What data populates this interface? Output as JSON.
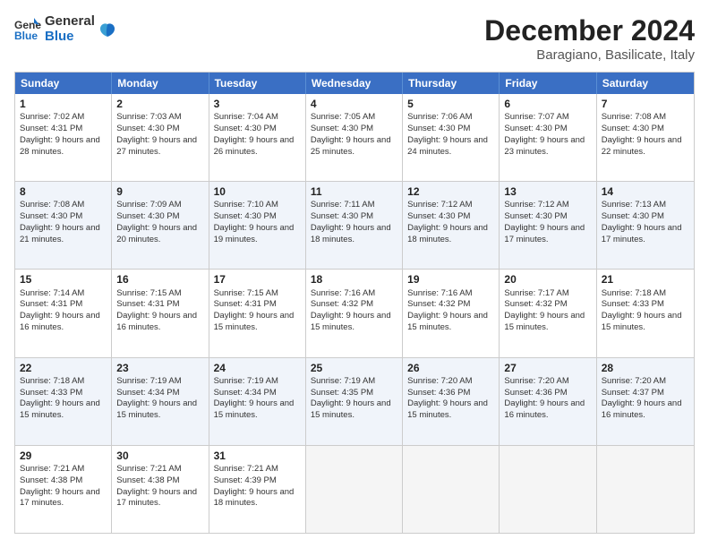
{
  "logo": {
    "line1": "General",
    "line2": "Blue"
  },
  "title": "December 2024",
  "subtitle": "Baragiano, Basilicate, Italy",
  "days": [
    "Sunday",
    "Monday",
    "Tuesday",
    "Wednesday",
    "Thursday",
    "Friday",
    "Saturday"
  ],
  "rows": [
    [
      {
        "day": "1",
        "info": "Sunrise: 7:02 AM\nSunset: 4:31 PM\nDaylight: 9 hours and 28 minutes."
      },
      {
        "day": "2",
        "info": "Sunrise: 7:03 AM\nSunset: 4:30 PM\nDaylight: 9 hours and 27 minutes."
      },
      {
        "day": "3",
        "info": "Sunrise: 7:04 AM\nSunset: 4:30 PM\nDaylight: 9 hours and 26 minutes."
      },
      {
        "day": "4",
        "info": "Sunrise: 7:05 AM\nSunset: 4:30 PM\nDaylight: 9 hours and 25 minutes."
      },
      {
        "day": "5",
        "info": "Sunrise: 7:06 AM\nSunset: 4:30 PM\nDaylight: 9 hours and 24 minutes."
      },
      {
        "day": "6",
        "info": "Sunrise: 7:07 AM\nSunset: 4:30 PM\nDaylight: 9 hours and 23 minutes."
      },
      {
        "day": "7",
        "info": "Sunrise: 7:08 AM\nSunset: 4:30 PM\nDaylight: 9 hours and 22 minutes."
      }
    ],
    [
      {
        "day": "8",
        "info": "Sunrise: 7:08 AM\nSunset: 4:30 PM\nDaylight: 9 hours and 21 minutes."
      },
      {
        "day": "9",
        "info": "Sunrise: 7:09 AM\nSunset: 4:30 PM\nDaylight: 9 hours and 20 minutes."
      },
      {
        "day": "10",
        "info": "Sunrise: 7:10 AM\nSunset: 4:30 PM\nDaylight: 9 hours and 19 minutes."
      },
      {
        "day": "11",
        "info": "Sunrise: 7:11 AM\nSunset: 4:30 PM\nDaylight: 9 hours and 18 minutes."
      },
      {
        "day": "12",
        "info": "Sunrise: 7:12 AM\nSunset: 4:30 PM\nDaylight: 9 hours and 18 minutes."
      },
      {
        "day": "13",
        "info": "Sunrise: 7:12 AM\nSunset: 4:30 PM\nDaylight: 9 hours and 17 minutes."
      },
      {
        "day": "14",
        "info": "Sunrise: 7:13 AM\nSunset: 4:30 PM\nDaylight: 9 hours and 17 minutes."
      }
    ],
    [
      {
        "day": "15",
        "info": "Sunrise: 7:14 AM\nSunset: 4:31 PM\nDaylight: 9 hours and 16 minutes."
      },
      {
        "day": "16",
        "info": "Sunrise: 7:15 AM\nSunset: 4:31 PM\nDaylight: 9 hours and 16 minutes."
      },
      {
        "day": "17",
        "info": "Sunrise: 7:15 AM\nSunset: 4:31 PM\nDaylight: 9 hours and 15 minutes."
      },
      {
        "day": "18",
        "info": "Sunrise: 7:16 AM\nSunset: 4:32 PM\nDaylight: 9 hours and 15 minutes."
      },
      {
        "day": "19",
        "info": "Sunrise: 7:16 AM\nSunset: 4:32 PM\nDaylight: 9 hours and 15 minutes."
      },
      {
        "day": "20",
        "info": "Sunrise: 7:17 AM\nSunset: 4:32 PM\nDaylight: 9 hours and 15 minutes."
      },
      {
        "day": "21",
        "info": "Sunrise: 7:18 AM\nSunset: 4:33 PM\nDaylight: 9 hours and 15 minutes."
      }
    ],
    [
      {
        "day": "22",
        "info": "Sunrise: 7:18 AM\nSunset: 4:33 PM\nDaylight: 9 hours and 15 minutes."
      },
      {
        "day": "23",
        "info": "Sunrise: 7:19 AM\nSunset: 4:34 PM\nDaylight: 9 hours and 15 minutes."
      },
      {
        "day": "24",
        "info": "Sunrise: 7:19 AM\nSunset: 4:34 PM\nDaylight: 9 hours and 15 minutes."
      },
      {
        "day": "25",
        "info": "Sunrise: 7:19 AM\nSunset: 4:35 PM\nDaylight: 9 hours and 15 minutes."
      },
      {
        "day": "26",
        "info": "Sunrise: 7:20 AM\nSunset: 4:36 PM\nDaylight: 9 hours and 15 minutes."
      },
      {
        "day": "27",
        "info": "Sunrise: 7:20 AM\nSunset: 4:36 PM\nDaylight: 9 hours and 16 minutes."
      },
      {
        "day": "28",
        "info": "Sunrise: 7:20 AM\nSunset: 4:37 PM\nDaylight: 9 hours and 16 minutes."
      }
    ],
    [
      {
        "day": "29",
        "info": "Sunrise: 7:21 AM\nSunset: 4:38 PM\nDaylight: 9 hours and 17 minutes."
      },
      {
        "day": "30",
        "info": "Sunrise: 7:21 AM\nSunset: 4:38 PM\nDaylight: 9 hours and 17 minutes."
      },
      {
        "day": "31",
        "info": "Sunrise: 7:21 AM\nSunset: 4:39 PM\nDaylight: 9 hours and 18 minutes."
      },
      null,
      null,
      null,
      null
    ]
  ]
}
